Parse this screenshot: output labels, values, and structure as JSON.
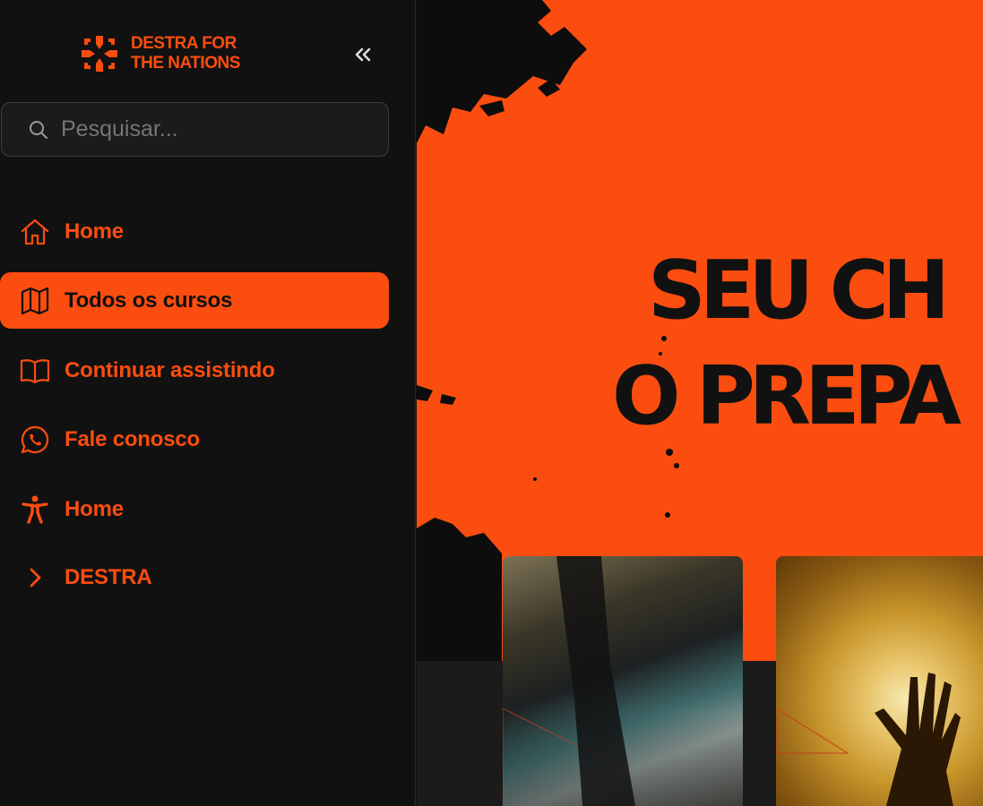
{
  "brand": {
    "logo_text": "DESTRA FOR\nTHE NATIONS",
    "icon": "destra-cross-logo"
  },
  "sidebar": {
    "collapse_icon": "double-chevron-left-icon",
    "search": {
      "placeholder": "Pesquisar...",
      "value": "",
      "icon": "search-icon"
    },
    "items": [
      {
        "label": "Home",
        "icon": "home-icon",
        "active": false
      },
      {
        "label": "Todos os cursos",
        "icon": "map-icon",
        "active": true
      },
      {
        "label": "Continuar assistindo",
        "icon": "book-open-icon",
        "active": false
      },
      {
        "label": "Fale conosco",
        "icon": "whatsapp-icon",
        "active": false
      },
      {
        "label": "Home",
        "icon": "accessibility-icon",
        "active": false
      },
      {
        "label": "DESTRA",
        "icon": "chevron-right-icon",
        "active": false
      }
    ]
  },
  "hero": {
    "title_line1": "SEU CH",
    "title_line2": "O PREPA"
  },
  "colors": {
    "accent": "#fb4d0f",
    "sidebar_bg": "#111111",
    "text_dark": "#111111",
    "placeholder": "#9a9a9a"
  }
}
